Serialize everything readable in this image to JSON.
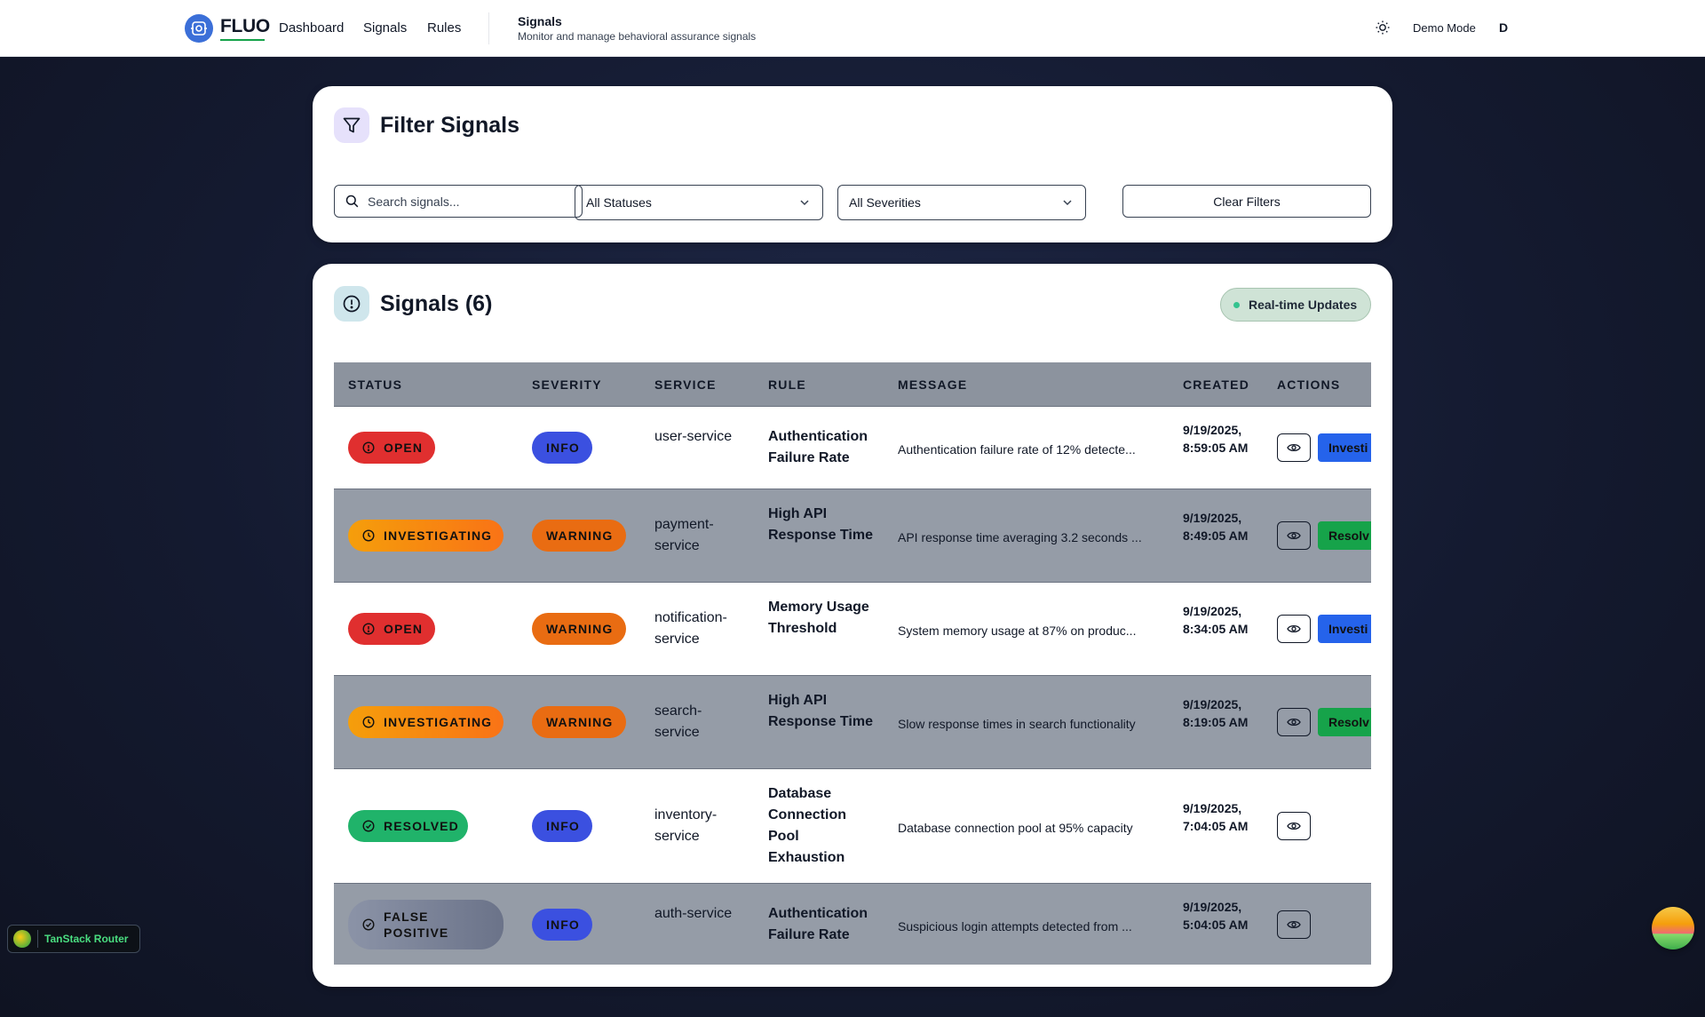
{
  "nav": {
    "brand": "FLUO",
    "links": [
      "Dashboard",
      "Signals",
      "Rules"
    ],
    "page_title": "Signals",
    "page_subtitle": "Monitor and manage behavioral assurance signals",
    "demo_mode": "Demo Mode",
    "user_initial": "D"
  },
  "filter": {
    "title": "Filter Signals",
    "search_placeholder": "Search signals...",
    "status_select": "All Statuses",
    "severity_select": "All Severities",
    "clear_button": "Clear Filters"
  },
  "signals": {
    "title": "Signals (6)",
    "realtime_badge": "Real-time Updates",
    "columns": [
      "STATUS",
      "SEVERITY",
      "SERVICE",
      "RULE",
      "MESSAGE",
      "CREATED",
      "ACTIONS"
    ],
    "rows": [
      {
        "status": "OPEN",
        "severity": "INFO",
        "service": "user-service",
        "rule": "Authentication Failure Rate",
        "message": "Authentication failure rate of 12% detecte...",
        "created": "9/19/2025, 8:59:05 AM",
        "action": "Investi"
      },
      {
        "status": "INVESTIGATING",
        "severity": "WARNING",
        "service": "payment-service",
        "rule": "High API Response Time",
        "message": "API response time averaging 3.2 seconds ...",
        "created": "9/19/2025, 8:49:05 AM",
        "action": "Resolv"
      },
      {
        "status": "OPEN",
        "severity": "WARNING",
        "service": "notification-service",
        "rule": "Memory Usage Threshold",
        "message": "System memory usage at 87% on produc...",
        "created": "9/19/2025, 8:34:05 AM",
        "action": "Investi"
      },
      {
        "status": "INVESTIGATING",
        "severity": "WARNING",
        "service": "search-service",
        "rule": "High API Response Time",
        "message": "Slow response times in search functionality",
        "created": "9/19/2025, 8:19:05 AM",
        "action": "Resolv"
      },
      {
        "status": "RESOLVED",
        "severity": "INFO",
        "service": "inventory-service",
        "rule": "Database Connection Pool Exhaustion",
        "message": "Database connection pool at 95% capacity",
        "created": "9/19/2025, 7:04:05 AM",
        "action": ""
      },
      {
        "status": "FALSE POSITIVE",
        "severity": "INFO",
        "service": "auth-service",
        "rule": "Authentication Failure Rate",
        "message": "Suspicious login attempts detected from ...",
        "created": "9/19/2025, 5:04:05 AM",
        "action": ""
      }
    ]
  },
  "devtools": {
    "router_label": "TanStack Router"
  }
}
